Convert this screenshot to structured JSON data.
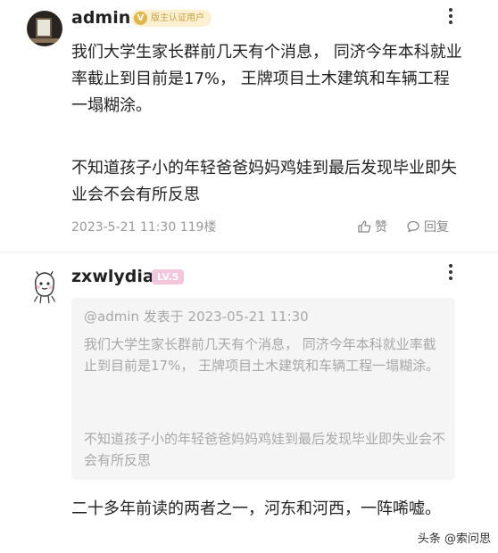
{
  "post1": {
    "username": "admin",
    "badge": "版主认证用户",
    "content_p1": "我们大学生家长群前几天有个消息， 同济今年本科就业率截止到目前是17%， 王牌项目土木建筑和车辆工程一塌糊涂。",
    "content_p2": "不知道孩子小的年轻爸爸妈妈鸡娃到最后发现毕业即失业会不会有所反思",
    "timestamp": "2023-5-21 11:30",
    "floor": "119楼",
    "like_label": "赞",
    "reply_label": "回复"
  },
  "post2": {
    "username": "zxwlydia",
    "level_badge": "LV.5",
    "quote": {
      "header": "@admin 发表于 2023-05-21 11:30",
      "p1": "我们大学生家长群前几天有个消息， 同济今年本科就业率截止到目前是17%， 王牌项目土木建筑和车辆工程一塌糊涂。",
      "p2": "不知道孩子小的年轻爸爸妈妈鸡娃到最后发现毕业即失业会不会有所反思"
    },
    "content": "二十多年前读的两者之一，河东和河西，一阵唏嘘。"
  },
  "watermark": "头条 @索问思",
  "colors": {
    "text": "#222222",
    "meta": "#999999",
    "quote_bg": "#f5f5f5",
    "quote_text": "#a8a8a8",
    "verified_bg": "#fbf0cf",
    "verified_text": "#c8a04a",
    "level_bg": "#f3c6dd"
  },
  "icons": {
    "like": "thumbs-up-icon",
    "reply": "comment-bubble-icon",
    "more": "more-vertical-icon"
  }
}
